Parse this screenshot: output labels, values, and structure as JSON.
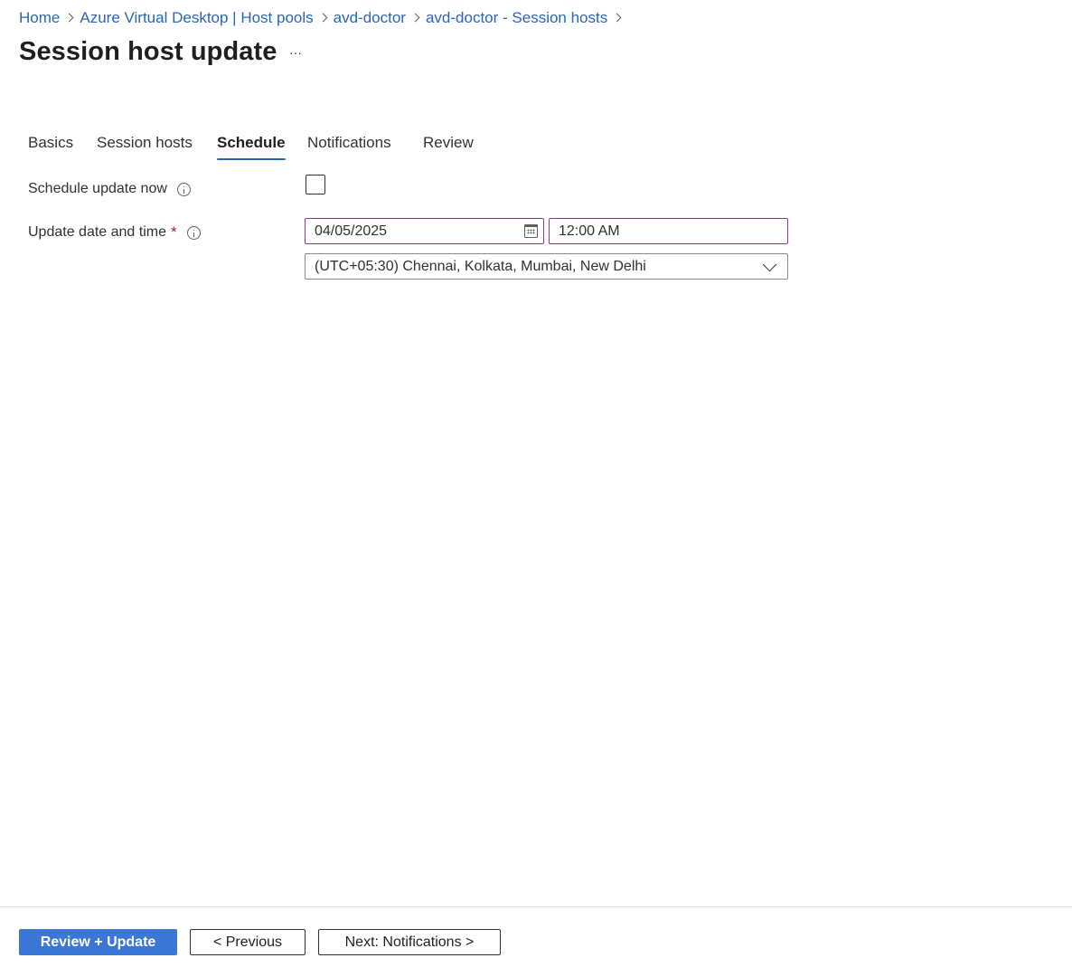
{
  "breadcrumb": {
    "items": [
      {
        "label": "Home"
      },
      {
        "label": "Azure Virtual Desktop | Host pools"
      },
      {
        "label": "avd-doctor"
      },
      {
        "label": "avd-doctor - Session hosts"
      }
    ]
  },
  "header": {
    "title": "Session host update",
    "more_label": "···"
  },
  "tabs": [
    {
      "label": "Basics",
      "active": false
    },
    {
      "label": "Session hosts",
      "active": false
    },
    {
      "label": "Schedule",
      "active": true
    },
    {
      "label": "Notifications",
      "active": false
    },
    {
      "label": "Review",
      "active": false
    }
  ],
  "form": {
    "schedule_now": {
      "label": "Schedule update now",
      "checked": false
    },
    "update_datetime": {
      "label": "Update date and time",
      "required_mark": "*",
      "date_value": "04/05/2025",
      "time_value": "12:00 AM",
      "timezone_value": "(UTC+05:30) Chennai, Kolkata, Mumbai, New Delhi"
    }
  },
  "footer": {
    "review_update_label": "Review + Update",
    "previous_label": "< Previous",
    "next_label": "Next: Notifications >"
  },
  "colors": {
    "link": "#2b66b4",
    "primary_button": "#3b77d6",
    "focused_field_border": "#8a3a96",
    "required": "#a4262c"
  }
}
